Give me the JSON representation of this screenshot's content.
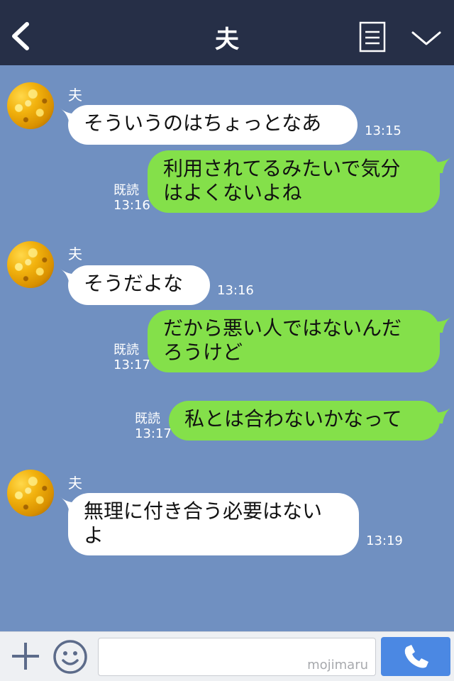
{
  "header": {
    "title": "夫",
    "back_icon": "chevron-left-icon",
    "notes_icon": "notes-icon",
    "dropdown_icon": "chevron-down-icon",
    "background": "#262f47"
  },
  "chat": {
    "background": "#7090c1",
    "incoming_bubble_color": "#ffffff",
    "outgoing_bubble_color": "#84e04a",
    "messages": [
      {
        "side": "left",
        "sender": "夫",
        "text": "そういうのはちょっとなあ",
        "time": "13:15"
      },
      {
        "side": "right",
        "read": "既読",
        "text": "利用されてるみたいで気分はよくないよね",
        "line1": "利用されてるみたいで気分",
        "line2": "はよくないよね",
        "time": "13:16"
      },
      {
        "side": "left",
        "sender": "夫",
        "text": "そうだよな",
        "time": "13:16"
      },
      {
        "side": "right",
        "read": "既読",
        "text": "だから悪い人ではないんだろうけど",
        "line1": "だから悪い人ではないんだ",
        "line2": "ろうけど",
        "time": "13:17"
      },
      {
        "side": "right",
        "read": "既読",
        "text": "私とは合わないかなって",
        "time": "13:17"
      },
      {
        "side": "left",
        "sender": "夫",
        "text": "無理に付き合う必要はないよ",
        "line1": "無理に付き合う必要はない",
        "line2": "よ",
        "time": "13:19"
      }
    ]
  },
  "footer": {
    "plus_icon": "plus-icon",
    "emoji_icon": "smiley-icon",
    "input_value": "",
    "watermark": "mojimaru",
    "call_icon": "phone-icon",
    "call_button_color": "#4b88e3"
  }
}
